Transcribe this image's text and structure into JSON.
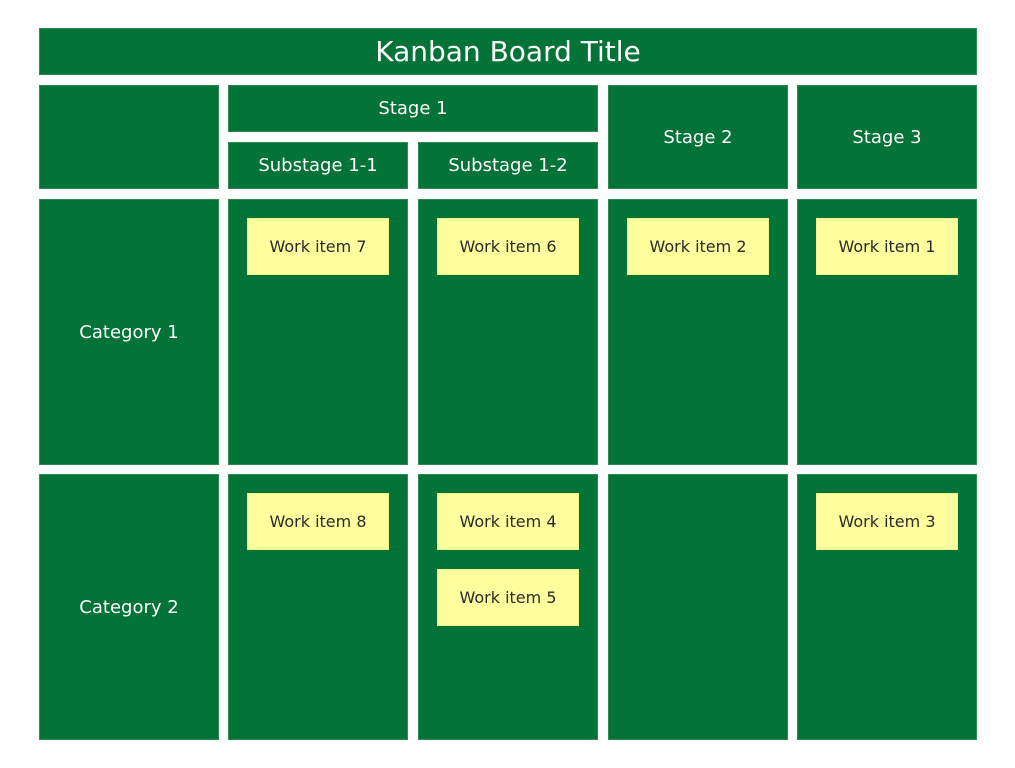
{
  "board": {
    "title": "Kanban Board Title",
    "stages": [
      {
        "label": "Stage 1",
        "substages": [
          "Substage 1-1",
          "Substage 1-2"
        ]
      },
      {
        "label": "Stage 2"
      },
      {
        "label": "Stage 3"
      }
    ],
    "categories": [
      "Category 1",
      "Category 2"
    ],
    "items": {
      "cat1_sub11": [
        "Work item 7"
      ],
      "cat1_sub12": [
        "Work item 6"
      ],
      "cat1_stage2": [
        "Work item 2"
      ],
      "cat1_stage3": [
        "Work item 1"
      ],
      "cat2_sub11": [
        "Work item 8"
      ],
      "cat2_sub12": [
        "Work item 4",
        "Work item 5"
      ],
      "cat2_stage2": [],
      "cat2_stage3": [
        "Work item 3"
      ]
    },
    "colors": {
      "cell": "#037337",
      "card": "#ffff9e",
      "header_text": "#ffffff",
      "card_text": "#2a2a2a"
    }
  }
}
